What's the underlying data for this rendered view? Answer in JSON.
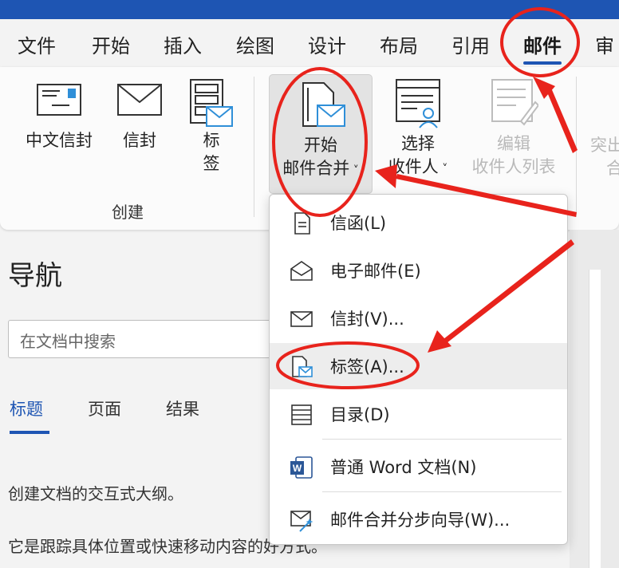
{
  "menubar": {
    "tabs": [
      {
        "label": "文件",
        "id": "file"
      },
      {
        "label": "开始",
        "id": "home"
      },
      {
        "label": "插入",
        "id": "insert"
      },
      {
        "label": "绘图",
        "id": "draw"
      },
      {
        "label": "设计",
        "id": "design"
      },
      {
        "label": "布局",
        "id": "layout"
      },
      {
        "label": "引用",
        "id": "references"
      },
      {
        "label": "邮件",
        "id": "mailings"
      },
      {
        "label": "审",
        "id": "review"
      }
    ],
    "active_tab": "邮件"
  },
  "ribbon": {
    "create_group": {
      "label": "创建",
      "chinese_envelope": "中文信封",
      "envelope": "信封",
      "labels_line1": "标",
      "labels_line2": "签"
    },
    "start_mail_merge": {
      "line1": "开始",
      "line2": "邮件合并"
    },
    "select_recipients": {
      "line1": "选择",
      "line2": "收件人"
    },
    "edit_recipients": {
      "line1": "编辑",
      "line2": "收件人列表"
    },
    "highlight_partial": {
      "line1": "突出",
      "line2": "合"
    }
  },
  "dropdown": {
    "items": [
      {
        "label": "信函(L)"
      },
      {
        "label": "电子邮件(E)"
      },
      {
        "label": "信封(V)..."
      },
      {
        "label": "标签(A)..."
      },
      {
        "label": "目录(D)"
      },
      {
        "label": "普通 Word 文档(N)"
      },
      {
        "label": "邮件合并分步向导(W)..."
      }
    ]
  },
  "navigation": {
    "title": "导航",
    "search_placeholder": "在文档中搜索",
    "tabs": [
      "标题",
      "页面",
      "结果"
    ],
    "line1": "创建文档的交互式大纲。",
    "line2": "它是跟踪具体位置或快速移动内容的好方式。"
  },
  "colors": {
    "accent": "#1e55b3",
    "annotation": "#e8231c",
    "envelope_blue": "#2f8fd8"
  }
}
